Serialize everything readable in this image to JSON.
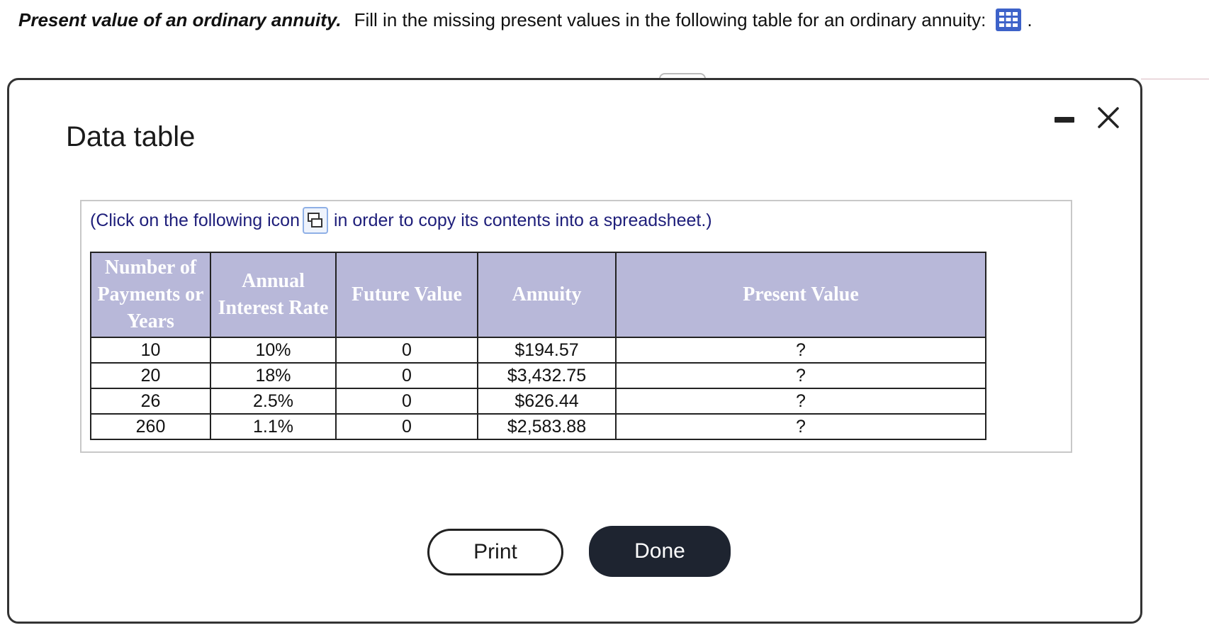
{
  "question": {
    "title": "Present value of an ordinary annuity.",
    "text": "Fill in the missing present values in the following table for an ordinary annuity:",
    "icon": "table-grid-icon",
    "trailing": "."
  },
  "dialog": {
    "title": "Data table",
    "copy_prefix": "(Click on the following icon",
    "copy_suffix": "in order to copy its contents into a spreadsheet.)",
    "columns": [
      "Number of Payments or Years",
      "Annual Interest Rate",
      "Future Value",
      "Annuity",
      "Present Value"
    ],
    "rows": [
      [
        "10",
        "10%",
        "0",
        "$194.57",
        "?"
      ],
      [
        "20",
        "18%",
        "0",
        "$3,432.75",
        "?"
      ],
      [
        "26",
        "2.5%",
        "0",
        "$626.44",
        "?"
      ],
      [
        "260",
        "1.1%",
        "0",
        "$2,583.88",
        "?"
      ]
    ],
    "print_label": "Print",
    "done_label": "Done"
  },
  "colors": {
    "header_bg": "#b8b8d9",
    "grid_icon": "#3d62c9",
    "done_bg": "#1e2430",
    "copy_text": "#1e1e7a"
  }
}
